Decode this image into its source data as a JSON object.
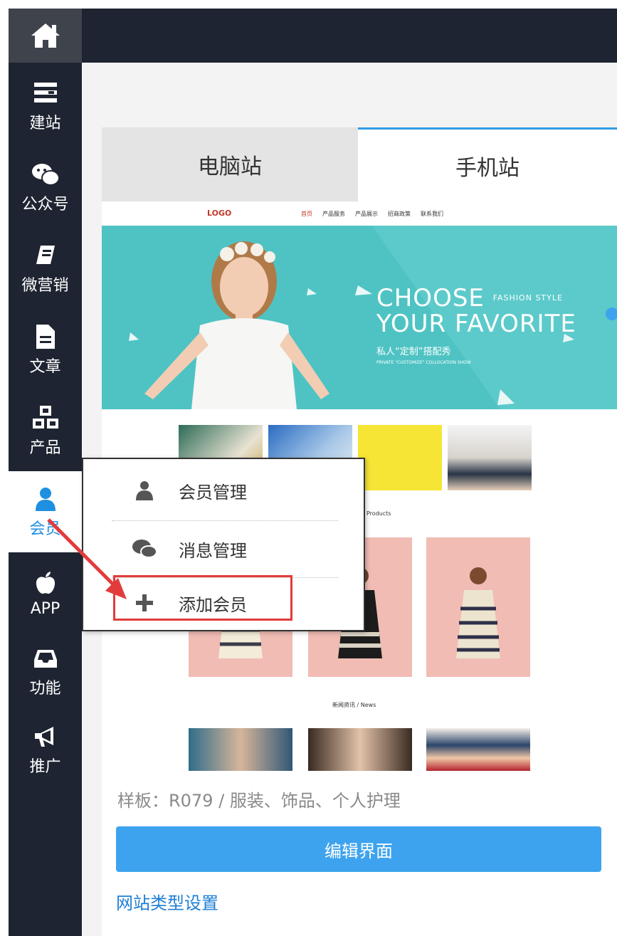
{
  "sidebar": {
    "items": [
      {
        "label": "建站",
        "icon": "list-icon"
      },
      {
        "label": "公众号",
        "icon": "wechat-icon"
      },
      {
        "label": "微营销",
        "icon": "book-icon"
      },
      {
        "label": "文章",
        "icon": "document-icon"
      },
      {
        "label": "产品",
        "icon": "cubes-icon"
      },
      {
        "label": "会员",
        "icon": "user-icon"
      },
      {
        "label": "APP",
        "icon": "apple-icon"
      },
      {
        "label": "功能",
        "icon": "inbox-icon"
      },
      {
        "label": "推广",
        "icon": "megaphone-icon"
      }
    ],
    "active": "会员"
  },
  "tabs": {
    "pc": "电脑站",
    "mobile": "手机站"
  },
  "preview": {
    "logo": "LOGO",
    "nav_links": [
      "首页",
      "产品服务",
      "产品展示",
      "招商政策",
      "联系我们"
    ],
    "banner": {
      "line1": "CHOOSE",
      "line1_small": "FASHION STYLE",
      "line2": "YOUR FAVORITE",
      "line3": "私人“定制”搭配秀",
      "line4": "PRIVATE \"CUSTOMIZE\" COLLOCATION SHOW"
    },
    "products_label": "Products",
    "news_label": "新闻资讯 / News"
  },
  "popup": {
    "items": [
      {
        "label": "会员管理",
        "icon": "user-icon"
      },
      {
        "label": "消息管理",
        "icon": "chat-bubbles-icon"
      },
      {
        "label": "添加会员",
        "icon": "plus-icon"
      }
    ]
  },
  "template_info": "样板：R079 / 服装、饰品、个人护理",
  "edit_button": "编辑界面",
  "site_type_link": "网站类型设置",
  "colors": {
    "sidebar": "#1e2431",
    "accent": "#3da3ee",
    "highlight": "#e23b3b"
  }
}
